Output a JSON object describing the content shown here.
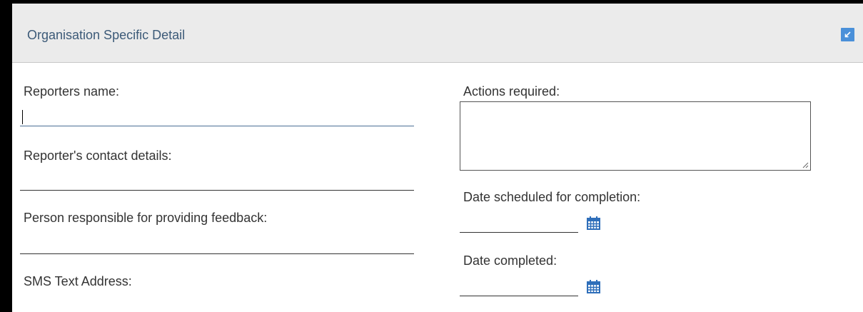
{
  "panel": {
    "title": "Organisation Specific Detail",
    "collapse_icon": "collapse-arrow-icon"
  },
  "left_fields": {
    "reporters_name": {
      "label": "Reporters name:",
      "value": ""
    },
    "contact_details": {
      "label": "Reporter's contact details:",
      "value": ""
    },
    "feedback_person": {
      "label": "Person responsible for providing feedback:",
      "value": ""
    },
    "sms_address": {
      "label": "SMS Text Address:",
      "value": ""
    }
  },
  "right_fields": {
    "actions_required": {
      "label": "Actions required:",
      "value": ""
    },
    "date_scheduled": {
      "label": "Date scheduled for completion:",
      "value": "",
      "icon": "calendar-icon"
    },
    "date_completed": {
      "label": "Date completed:",
      "value": "",
      "icon": "calendar-icon"
    }
  },
  "colors": {
    "header_bg": "#ebebeb",
    "title_text": "#3c5a78",
    "accent": "#4a90d9",
    "calendar": "#2f6fba",
    "label_text": "#333333"
  }
}
